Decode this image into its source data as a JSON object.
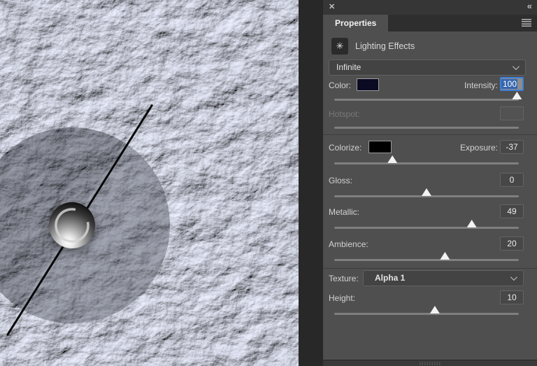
{
  "icons": {
    "close": "✕",
    "collapse_left": "«",
    "light_effect": "✳"
  },
  "panel": {
    "tab_label": "Properties",
    "effect_title": "Lighting Effects",
    "light_type": "Infinite",
    "color": {
      "label": "Color:",
      "swatch": "#0a0b23"
    },
    "intensity": {
      "label": "Intensity:",
      "value": "100",
      "slider_pct": 99
    },
    "hotspot": {
      "label": "Hotspot:",
      "value": "",
      "disabled": true
    },
    "colorize": {
      "label": "Colorize:",
      "swatch": "#000000"
    },
    "exposure": {
      "label": "Exposure:",
      "value": "-37",
      "slider_pct": 31.5
    },
    "gloss": {
      "label": "Gloss:",
      "value": "0",
      "slider_pct": 50
    },
    "metallic": {
      "label": "Metallic:",
      "value": "49",
      "slider_pct": 74.5
    },
    "ambience": {
      "label": "Ambience:",
      "value": "20",
      "slider_pct": 60
    },
    "texture": {
      "label": "Texture:",
      "value": "Alpha 1"
    },
    "height": {
      "label": "Height:",
      "value": "10",
      "slider_pct": 54.5
    }
  },
  "colors": {
    "selection_blue": "#3666ad",
    "focus_border": "#3e7fd8",
    "panel_bg": "#4f4f4f",
    "canvas_light": "#e9edfc"
  }
}
